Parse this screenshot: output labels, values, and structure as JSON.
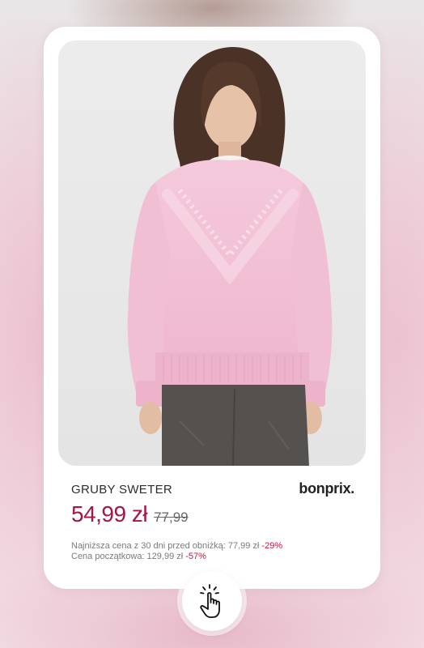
{
  "product": {
    "name": "GRUBY SWETER",
    "brand": "bonprix.",
    "price_current": "54,99 zł",
    "price_old": "77,99",
    "lowest_price_label": "Najniższa cena z 30 dni  przed obniżką: 77,99 zł",
    "lowest_price_discount": "-29%",
    "initial_price_label": "Cena początkowa: 129,99 zł",
    "initial_price_discount": "-57%",
    "image_alt": "product-photo"
  },
  "colors": {
    "price": "#a31645",
    "discount": "#c8163f",
    "sweater": "#f2c0d6"
  },
  "icons": {
    "tap": "hand-tap-icon"
  }
}
